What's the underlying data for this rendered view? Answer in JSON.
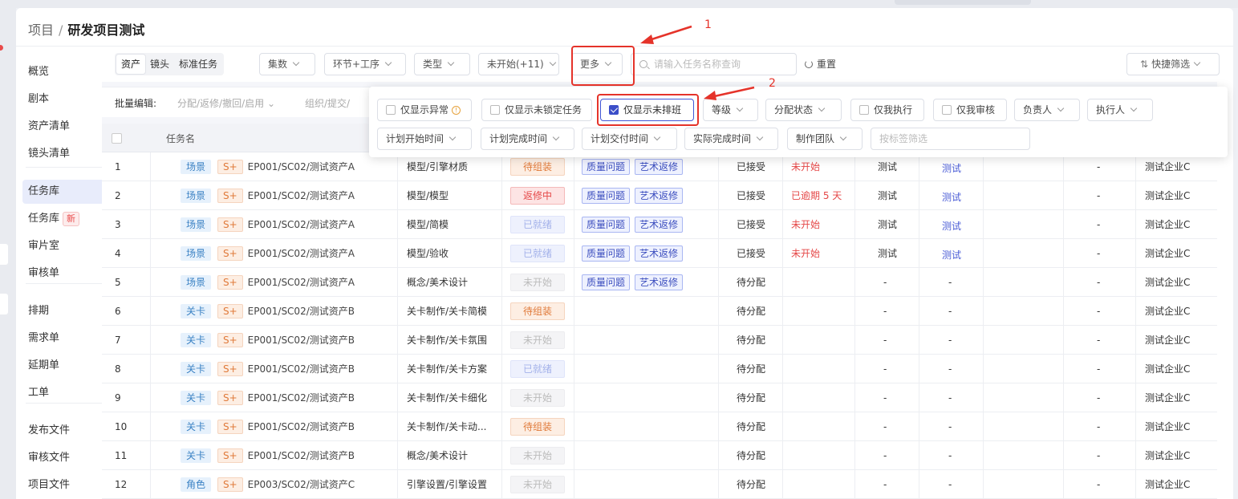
{
  "breadcrumb": {
    "parent": "项目",
    "separator": "/",
    "current": "研发项目测试"
  },
  "sidebar": {
    "items": [
      {
        "label": "概览"
      },
      {
        "label": "剧本"
      },
      {
        "label": "资产清单"
      },
      {
        "label": "镜头清单"
      },
      {
        "label": "任务库"
      },
      {
        "label": "任务库",
        "badge": "新"
      },
      {
        "label": "审片室"
      },
      {
        "label": "审核单"
      },
      {
        "label": "排期"
      },
      {
        "label": "需求单"
      },
      {
        "label": "延期单"
      },
      {
        "label": "工单"
      },
      {
        "label": "发布文件"
      },
      {
        "label": "审核文件"
      },
      {
        "label": "项目文件"
      }
    ],
    "active_index": 4
  },
  "filters": {
    "segment": [
      "资产",
      "镜头",
      "标准任务"
    ],
    "segment_active": 0,
    "dropdowns": [
      "集数",
      "环节+工序",
      "类型",
      "未开始(+11)",
      "更多"
    ],
    "search_placeholder": "请输入任务名称查询",
    "reset": "重置",
    "quick": "快捷筛选"
  },
  "batch": {
    "label": "批量编辑:",
    "actions": [
      "分配/返修/撤回/启用",
      "组织/提交/"
    ]
  },
  "table": {
    "header": "任务名",
    "rows": [
      {
        "no": "1",
        "type": "场景",
        "level": "S+",
        "name": "EP001/SC02/测试资产A",
        "step": "模型/引擎材质",
        "status": "待组装",
        "st": "pend",
        "issues": [
          "质量问题",
          "艺术返修"
        ],
        "assign": "已接受",
        "time": "未开始",
        "owner": "测试",
        "exec": "测试",
        "c11": "-",
        "company": "测试企业C"
      },
      {
        "no": "2",
        "type": "场景",
        "level": "S+",
        "name": "EP001/SC02/测试资产A",
        "step": "模型/模型",
        "status": "返修中",
        "st": "rework",
        "issues": [
          "质量问题",
          "艺术返修"
        ],
        "assign": "已接受",
        "time": "已逾期 5 天",
        "owner": "测试",
        "exec": "测试",
        "c11": "-",
        "company": "测试企业C"
      },
      {
        "no": "3",
        "type": "场景",
        "level": "S+",
        "name": "EP001/SC02/测试资产A",
        "step": "模型/简模",
        "status": "已就绪",
        "st": "ready",
        "issues": [
          "质量问题",
          "艺术返修"
        ],
        "assign": "已接受",
        "time": "未开始",
        "owner": "测试",
        "exec": "测试",
        "c11": "-",
        "company": "测试企业C"
      },
      {
        "no": "4",
        "type": "场景",
        "level": "S+",
        "name": "EP001/SC02/测试资产A",
        "step": "模型/验收",
        "status": "已就绪",
        "st": "ready",
        "issues": [
          "质量问题",
          "艺术返修"
        ],
        "assign": "已接受",
        "time": "未开始",
        "owner": "测试",
        "exec": "测试",
        "c11": "-",
        "company": "测试企业C"
      },
      {
        "no": "5",
        "type": "场景",
        "level": "S+",
        "name": "EP001/SC02/测试资产A",
        "step": "概念/美术设计",
        "status": "未开始",
        "st": "not",
        "issues": [
          "质量问题",
          "艺术返修"
        ],
        "assign": "待分配",
        "time": "",
        "owner": "-",
        "exec": "-",
        "c11": "-",
        "company": "测试企业C"
      },
      {
        "no": "6",
        "type": "关卡",
        "level": "S+",
        "name": "EP001/SC02/测试资产B",
        "step": "关卡制作/关卡简模",
        "status": "待组装",
        "st": "pend",
        "issues": [],
        "assign": "待分配",
        "time": "",
        "owner": "-",
        "exec": "-",
        "c11": "-",
        "company": "测试企业C"
      },
      {
        "no": "7",
        "type": "关卡",
        "level": "S+",
        "name": "EP001/SC02/测试资产B",
        "step": "关卡制作/关卡氛围",
        "status": "未开始",
        "st": "not",
        "issues": [],
        "assign": "待分配",
        "time": "",
        "owner": "-",
        "exec": "-",
        "c11": "-",
        "company": "测试企业C"
      },
      {
        "no": "8",
        "type": "关卡",
        "level": "S+",
        "name": "EP001/SC02/测试资产B",
        "step": "关卡制作/关卡方案",
        "status": "已就绪",
        "st": "ready",
        "issues": [],
        "assign": "待分配",
        "time": "",
        "owner": "-",
        "exec": "-",
        "c11": "-",
        "company": "测试企业C"
      },
      {
        "no": "9",
        "type": "关卡",
        "level": "S+",
        "name": "EP001/SC02/测试资产B",
        "step": "关卡制作/关卡细化",
        "status": "未开始",
        "st": "not",
        "issues": [],
        "assign": "待分配",
        "time": "",
        "owner": "-",
        "exec": "-",
        "c11": "-",
        "company": "测试企业C"
      },
      {
        "no": "10",
        "type": "关卡",
        "level": "S+",
        "name": "EP001/SC02/测试资产B",
        "step": "关卡制作/关卡动...",
        "status": "待组装",
        "st": "pend",
        "issues": [],
        "assign": "待分配",
        "time": "",
        "owner": "-",
        "exec": "-",
        "c11": "-",
        "company": "测试企业C"
      },
      {
        "no": "11",
        "type": "关卡",
        "level": "S+",
        "name": "EP001/SC02/测试资产B",
        "step": "概念/美术设计",
        "status": "未开始",
        "st": "not",
        "issues": [],
        "assign": "待分配",
        "time": "",
        "owner": "-",
        "exec": "-",
        "c11": "-",
        "company": "测试企业C"
      },
      {
        "no": "12",
        "type": "角色",
        "level": "S+",
        "name": "EP003/SC02/测试资产C",
        "step": "引擎设置/引擎设置",
        "status": "未开始",
        "st": "not",
        "issues": [],
        "assign": "待分配",
        "time": "",
        "owner": "-",
        "exec": "-",
        "c11": "-",
        "company": "测试企业C"
      }
    ]
  },
  "more_popup": {
    "row1": [
      {
        "label": "仅显示异常",
        "kind": "check",
        "checked": false,
        "warn": "!"
      },
      {
        "label": "仅显示未锁定任务",
        "kind": "check",
        "checked": false
      },
      {
        "label": "仅显示未排班",
        "kind": "check",
        "checked": true
      },
      {
        "label": "等级",
        "kind": "dropdown"
      },
      {
        "label": "分配状态",
        "kind": "dropdown"
      },
      {
        "label": "仅我执行",
        "kind": "check",
        "checked": false
      },
      {
        "label": "仅我审核",
        "kind": "check",
        "checked": false
      },
      {
        "label": "负责人",
        "kind": "dropdown"
      },
      {
        "label": "执行人",
        "kind": "dropdown"
      }
    ],
    "row2": [
      {
        "label": "计划开始时间",
        "kind": "dropdown"
      },
      {
        "label": "计划完成时间",
        "kind": "dropdown"
      },
      {
        "label": "计划交付时间",
        "kind": "dropdown"
      },
      {
        "label": "实际完成时间",
        "kind": "dropdown"
      },
      {
        "label": "制作团队",
        "kind": "dropdown"
      },
      {
        "label": "按标签筛选",
        "kind": "placeholder"
      }
    ]
  },
  "annotations": {
    "step1": "1",
    "step2": "2"
  },
  "colors": {
    "accent": "#3b4ec8",
    "annotation": "#e5332a"
  }
}
